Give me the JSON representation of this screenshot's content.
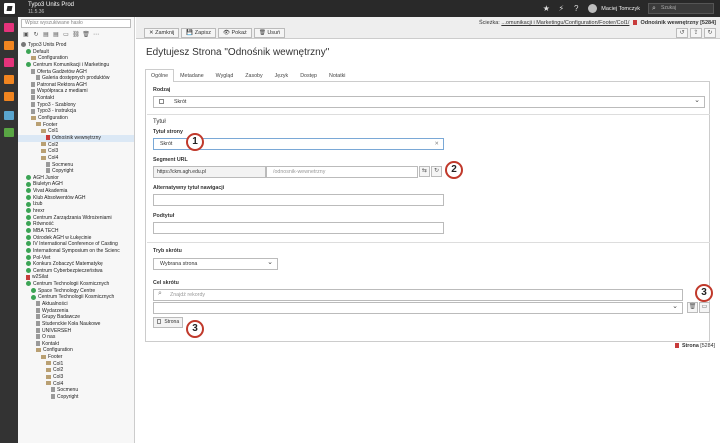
{
  "topbar": {
    "site_name": "Typo3 Units Prod",
    "version": "11.5.36",
    "user": "Maciej Tomczyk",
    "search_placeholder": "Szukaj"
  },
  "modules": [
    {
      "icon": "page-module-icon",
      "color": "#e5337b"
    },
    {
      "icon": "list-module-icon",
      "color": "#f18520"
    },
    {
      "icon": "view-module-icon",
      "color": "#e5337b"
    },
    {
      "icon": "info-module-icon",
      "color": "#f18520"
    },
    {
      "icon": "templates-module-icon",
      "color": "#f18520"
    },
    {
      "icon": "filelist-module-icon",
      "color": "#59a5ce"
    },
    {
      "icon": "extensions-module-icon",
      "color": "#59a644"
    }
  ],
  "tree": {
    "filter_placeholder": "Wpisz wyszukiwane hasło",
    "items": [
      {
        "depth": 0,
        "label": "Typo3 Units Prod",
        "icon": "globe"
      },
      {
        "depth": 1,
        "label": "Default",
        "icon": "green"
      },
      {
        "depth": 2,
        "label": "Configuration",
        "icon": "folder"
      },
      {
        "depth": 1,
        "label": "Centrum Komunikacji i Marketingu",
        "icon": "green"
      },
      {
        "depth": 2,
        "label": "Oferta Gadżetów AGH",
        "icon": "doc"
      },
      {
        "depth": 3,
        "label": "Galeria dostępnych produktów",
        "icon": "doc"
      },
      {
        "depth": 2,
        "label": "Patronat Rektora AGH",
        "icon": "doc"
      },
      {
        "depth": 2,
        "label": "Współpraca z mediami",
        "icon": "doc"
      },
      {
        "depth": 2,
        "label": "Kontakt",
        "icon": "doc"
      },
      {
        "depth": 2,
        "label": "Typo3 - Szablony",
        "icon": "doc"
      },
      {
        "depth": 2,
        "label": "Typo3 - instrukcja",
        "icon": "doc"
      },
      {
        "depth": 2,
        "label": "Configuration",
        "icon": "folder"
      },
      {
        "depth": 3,
        "label": "Footer",
        "icon": "folder"
      },
      {
        "depth": 4,
        "label": "Col1",
        "icon": "folder"
      },
      {
        "depth": 5,
        "label": "Odnośnik wewnętrzny",
        "icon": "link",
        "selected": true
      },
      {
        "depth": 4,
        "label": "Col2",
        "icon": "folder"
      },
      {
        "depth": 4,
        "label": "Col3",
        "icon": "folder"
      },
      {
        "depth": 4,
        "label": "Col4",
        "icon": "folder"
      },
      {
        "depth": 5,
        "label": "Socmenu",
        "icon": "doc"
      },
      {
        "depth": 5,
        "label": "Copyright",
        "icon": "doc"
      },
      {
        "depth": 1,
        "label": "AGH Junior",
        "icon": "green"
      },
      {
        "depth": 1,
        "label": "Biuletyn AGH",
        "icon": "green"
      },
      {
        "depth": 1,
        "label": "Vivat Akademia",
        "icon": "green"
      },
      {
        "depth": 1,
        "label": "Klub Absolwentów AGH",
        "icon": "green"
      },
      {
        "depth": 1,
        "label": "Iżub",
        "icon": "green"
      },
      {
        "depth": 1,
        "label": "hrexr",
        "icon": "green"
      },
      {
        "depth": 1,
        "label": "Centrum Zarządzania Wdrożeniami",
        "icon": "green"
      },
      {
        "depth": 1,
        "label": "Równość",
        "icon": "green"
      },
      {
        "depth": 1,
        "label": "MBA TECH",
        "icon": "green"
      },
      {
        "depth": 1,
        "label": "Ośrodek AGH w Łukęcinie",
        "icon": "green"
      },
      {
        "depth": 1,
        "label": "IV International Conference of Casting",
        "icon": "green"
      },
      {
        "depth": 1,
        "label": "International Symposium on the Scienc",
        "icon": "green"
      },
      {
        "depth": 1,
        "label": "Pol-Viet",
        "icon": "green"
      },
      {
        "depth": 1,
        "label": "Konkurs Zobaczyć Matematykę",
        "icon": "green"
      },
      {
        "depth": 1,
        "label": "Centrum Cyberbezpieczeństwa",
        "icon": "green"
      },
      {
        "depth": 1,
        "label": "w2Silat",
        "icon": "link"
      },
      {
        "depth": 1,
        "label": "Centrum Technologii Kosmicznych",
        "icon": "green"
      },
      {
        "depth": 2,
        "label": "Space Technology Centre",
        "icon": "green"
      },
      {
        "depth": 2,
        "label": "Centrum Technologii Kosmicznych",
        "icon": "green"
      },
      {
        "depth": 3,
        "label": "Aktualności",
        "icon": "doc"
      },
      {
        "depth": 3,
        "label": "Wydarzenia",
        "icon": "doc"
      },
      {
        "depth": 3,
        "label": "Grupy Badawcze",
        "icon": "doc"
      },
      {
        "depth": 3,
        "label": "Studenckie Koła Naukowe",
        "icon": "doc"
      },
      {
        "depth": 3,
        "label": "UNIVERSEH",
        "icon": "doc"
      },
      {
        "depth": 3,
        "label": "O nas",
        "icon": "doc"
      },
      {
        "depth": 3,
        "label": "Kontakt",
        "icon": "doc"
      },
      {
        "depth": 3,
        "label": "Configuration",
        "icon": "folder"
      },
      {
        "depth": 4,
        "label": "Footer",
        "icon": "folder"
      },
      {
        "depth": 5,
        "label": "Col1",
        "icon": "folder"
      },
      {
        "depth": 5,
        "label": "Col2",
        "icon": "folder"
      },
      {
        "depth": 5,
        "label": "Col3",
        "icon": "folder"
      },
      {
        "depth": 5,
        "label": "Col4",
        "icon": "folder"
      },
      {
        "depth": 6,
        "label": "Socmenu",
        "icon": "doc"
      },
      {
        "depth": 6,
        "label": "Copyright",
        "icon": "doc"
      }
    ]
  },
  "docheader": {
    "path_prefix": "Ścieżka:",
    "path": "...omunikacji i Marketingu/Configuration/Footer/Col1/",
    "current_page": "Odnośnik wewnętrzny [5284]",
    "buttons": [
      "Zamknij",
      "Zapisz",
      "Pokaż",
      "Usuń"
    ]
  },
  "form": {
    "title": "Edytujesz Strona \"Odnośnik wewnętrzny\"",
    "tabs": [
      "Ogólne",
      "Metadane",
      "Wygląd",
      "Zasoby",
      "Język",
      "Dostęp",
      "Notatki"
    ],
    "active_tab": "Ogólne",
    "rodzaj_label": "Rodzaj",
    "rodzaj_value": "Skrót",
    "tytul_section": "Tytuł",
    "tytul_label": "Tytuł strony",
    "tytul_value": "Skrót",
    "segment_label": "Segment URL",
    "segment_prefix": "https://ckm.agh.edu.pl",
    "segment_value": "/odnosnik-wewnetrzny",
    "alt_title_label": "Alternatywny tytuł nawigacji",
    "subtitle_label": "Podtytuł",
    "shortcut_mode_label": "Tryb skrótu",
    "shortcut_mode_value": "Wybrana strona",
    "target_label": "Cel skrótu",
    "target_placeholder": "Znajdź rekordy",
    "page_chip": "Strona"
  },
  "footer": {
    "record": "Strona",
    "uid": "[5284]"
  },
  "callouts": [
    "1",
    "2",
    "3",
    "3"
  ]
}
